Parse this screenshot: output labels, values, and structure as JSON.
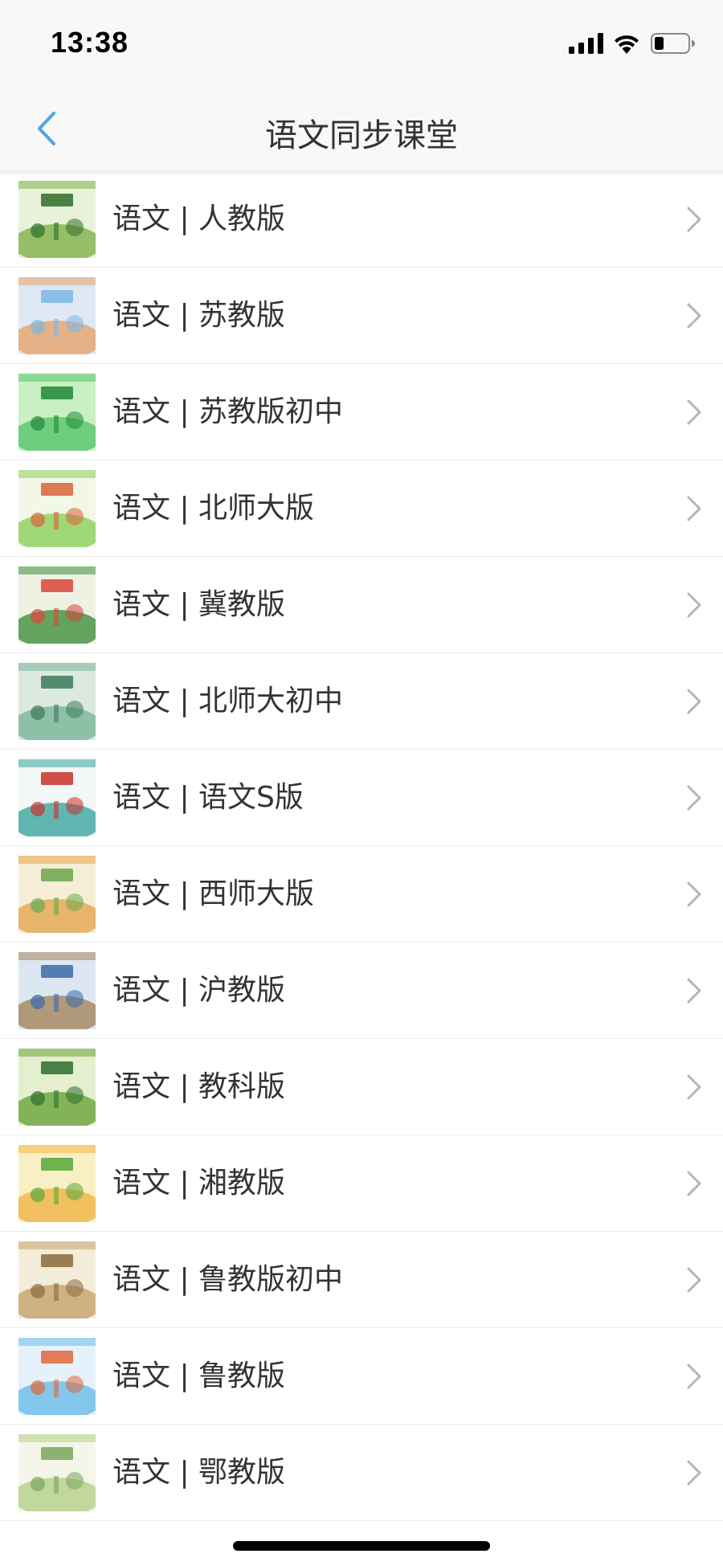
{
  "status_bar": {
    "time": "13:38"
  },
  "nav": {
    "title": "语文同步课堂",
    "back_icon": "chevron-left-icon"
  },
  "colors": {
    "accent": "#4aa6e0",
    "chevron": "#b5b5b5",
    "divider": "#ececec"
  },
  "list": {
    "items": [
      {
        "label": "语文 | 人教版",
        "cover": [
          "#e9f2d8",
          "#7fb24a",
          "#2f6e2a"
        ]
      },
      {
        "label": "语文 | 苏教版",
        "cover": [
          "#dfe9f5",
          "#e7a36c",
          "#7bb6e3"
        ]
      },
      {
        "label": "语文 | 苏教版初中",
        "cover": [
          "#c9f0c2",
          "#58c66b",
          "#1e8a3a"
        ]
      },
      {
        "label": "语文 | 北师大版",
        "cover": [
          "#f2f7e8",
          "#8ccf5a",
          "#d9633a"
        ]
      },
      {
        "label": "语文 | 冀教版",
        "cover": [
          "#eef2e2",
          "#3f8f3f",
          "#d9463a"
        ]
      },
      {
        "label": "语文 | 北师大初中",
        "cover": [
          "#dbe9e0",
          "#7ab59a",
          "#3c7a5a"
        ]
      },
      {
        "label": "语文 | 语文S版",
        "cover": [
          "#f3f7f6",
          "#3aa5a0",
          "#c9302c"
        ]
      },
      {
        "label": "语文 | 西师大版",
        "cover": [
          "#f5edd5",
          "#e4a650",
          "#6aa84f"
        ]
      },
      {
        "label": "语文 | 沪教版",
        "cover": [
          "#dde7f2",
          "#a5845c",
          "#3b6aa8"
        ]
      },
      {
        "label": "语文 | 教科版",
        "cover": [
          "#e4efcf",
          "#6aa43a",
          "#2d6e2d"
        ]
      },
      {
        "label": "语文 | 湘教版",
        "cover": [
          "#f7f0c4",
          "#f0b445",
          "#58a83a"
        ]
      },
      {
        "label": "语文 | 鲁教版初中",
        "cover": [
          "#f3ecd9",
          "#c6a46b",
          "#8a6a3a"
        ]
      },
      {
        "label": "语文 | 鲁教版",
        "cover": [
          "#e5f2fb",
          "#6abde8",
          "#e0673a"
        ]
      },
      {
        "label": "语文 | 鄂教版",
        "cover": [
          "#f4f6ea",
          "#b5cf88",
          "#7aa65a"
        ]
      }
    ]
  }
}
